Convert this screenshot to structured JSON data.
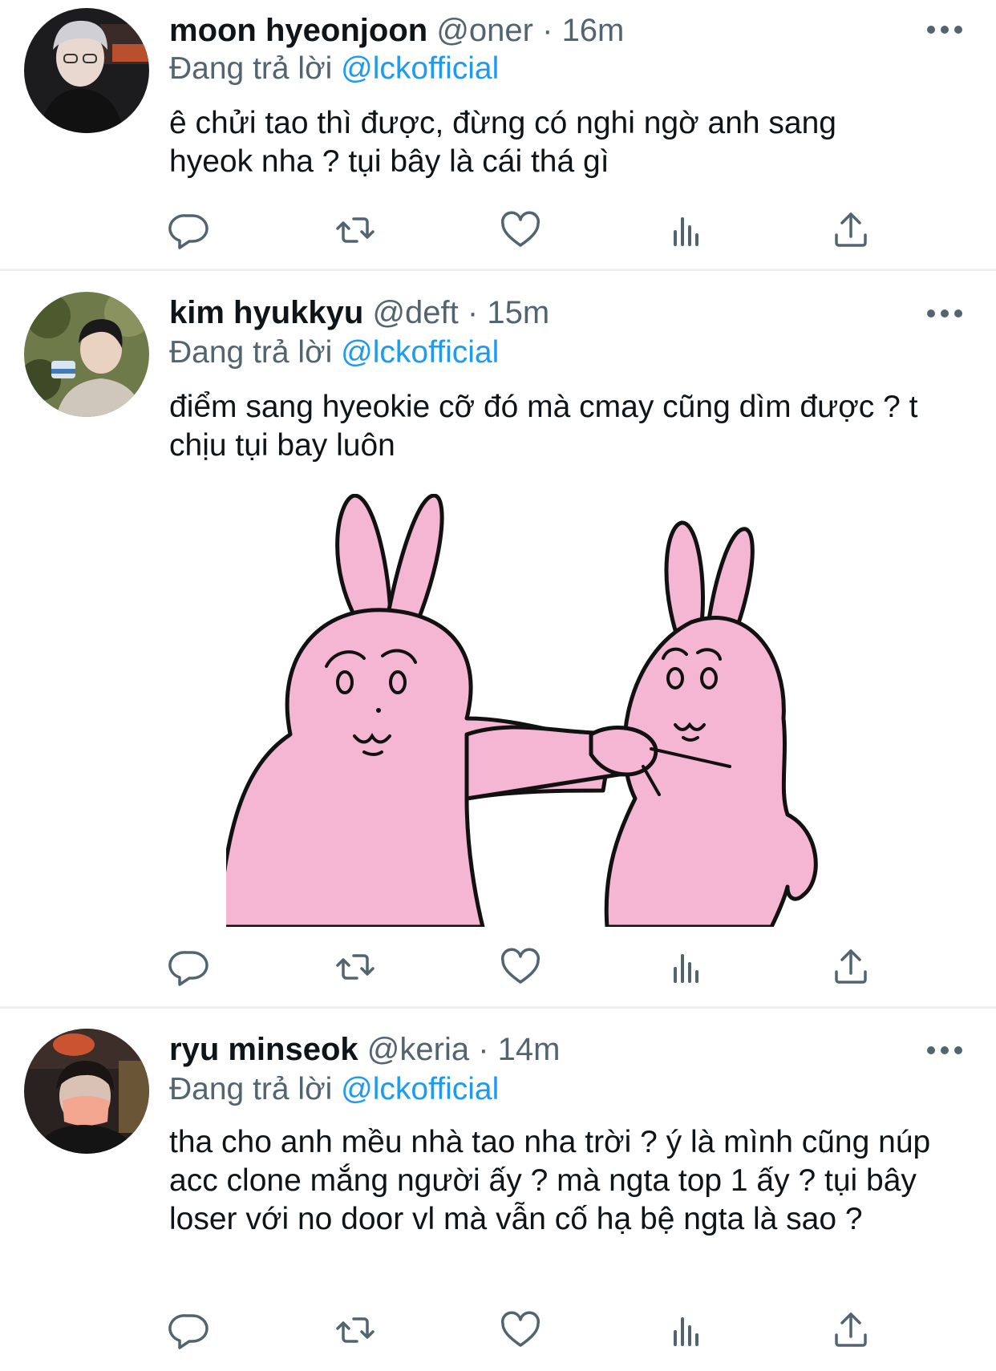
{
  "tweets": [
    {
      "name": "moon hyeonjoon",
      "handle": "@oner",
      "dot": "·",
      "time": "16m",
      "reply_prefix": "Đang trả lời",
      "reply_to": "@lckofficial",
      "text": "ê chửi tao thì được, đừng có nghi ngờ anh sang hyeok nha ? tụi bây là cái thá gì",
      "has_media": false
    },
    {
      "name": "kim hyukkyu",
      "handle": "@deft",
      "dot": "·",
      "time": "15m",
      "reply_prefix": "Đang trả lời",
      "reply_to": "@lckofficial",
      "text": "điểm sang hyeokie cỡ đó mà cmay cũng dìm được ? t chịu tụi bay luôn",
      "has_media": true
    },
    {
      "name": "ryu minseok",
      "handle": "@keria",
      "dot": "·",
      "time": "14m",
      "reply_prefix": "Đang trả lời",
      "reply_to": "@lckofficial",
      "text": "tha cho anh mều nhà tao nha trời ? ý là mình cũng núp acc clone mắng người ấy ? mà ngta top 1 ấy ? tụi bây loser với no door vl mà vẫn cố hạ bệ ngta là sao ?",
      "has_media": false
    }
  ],
  "icons": {
    "reply": "reply-icon",
    "retweet": "retweet-icon",
    "like": "like-icon",
    "views": "views-icon",
    "share": "share-icon",
    "more": "more-icon"
  },
  "colors": {
    "accent": "#1d9bf0",
    "secondary_text": "#536471",
    "bunny_pink": "#f5b6d3"
  }
}
